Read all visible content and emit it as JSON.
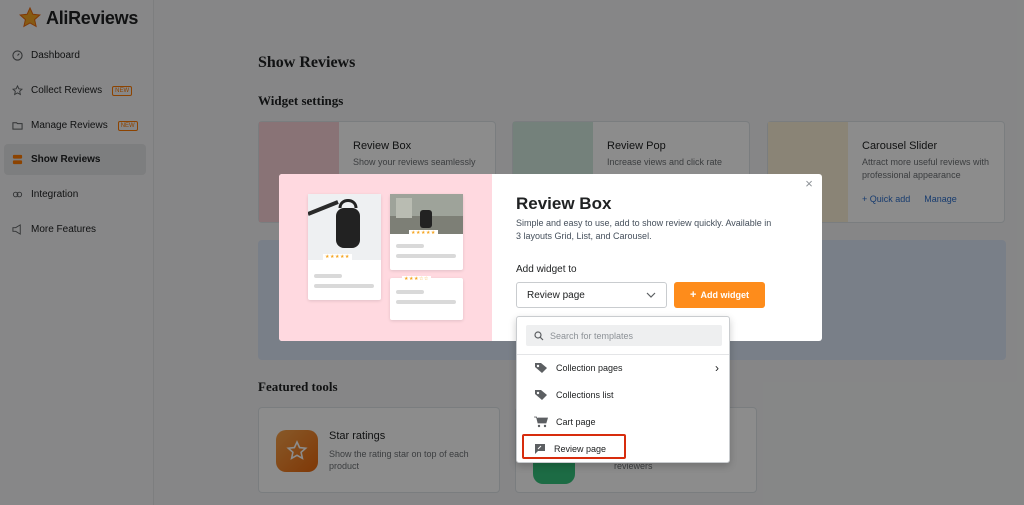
{
  "app": {
    "name": "AliReviews"
  },
  "sidebar": {
    "items": [
      {
        "label": "Dashboard",
        "icon": "dashboard-icon",
        "badge": ""
      },
      {
        "label": "Collect Reviews",
        "icon": "star-icon",
        "badge": "NEW"
      },
      {
        "label": "Manage Reviews",
        "icon": "folder-icon",
        "badge": "NEW"
      },
      {
        "label": "Show Reviews",
        "icon": "layout-icon",
        "badge": ""
      },
      {
        "label": "Integration",
        "icon": "integration-icon",
        "badge": ""
      },
      {
        "label": "More Features",
        "icon": "megaphone-icon",
        "badge": ""
      }
    ]
  },
  "main": {
    "page_title": "Show Reviews",
    "widget_settings_title": "Widget settings",
    "widgets": [
      {
        "title": "Review Box",
        "desc": "Show your reviews seamlessly"
      },
      {
        "title": "Review Pop",
        "desc": "Increase views and click rate"
      },
      {
        "title": "Carousel Slider",
        "desc": "Attract more useful reviews with professional appearance",
        "link1": "+ Quick add",
        "link2": "Manage"
      }
    ],
    "featured_title": "Featured tools",
    "featured": [
      {
        "title": "Star ratings",
        "desc": "Show the rating star on top of each product"
      },
      {
        "title": "",
        "desc": "reviewers"
      }
    ]
  },
  "modal": {
    "title": "Review Box",
    "desc": "Simple and easy to use, add to show review quickly. Available in 3 layouts Grid, List, and Carousel.",
    "add_to_label": "Add widget to",
    "select_value": "Review page",
    "add_button": "Add widget",
    "close": "×"
  },
  "dropdown": {
    "search_placeholder": "Search for templates",
    "items": [
      {
        "label": "Collection pages",
        "icon": "tag-icon"
      },
      {
        "label": "Collections list",
        "icon": "tags-icon"
      },
      {
        "label": "Cart page",
        "icon": "cart-icon"
      },
      {
        "label": "Review page",
        "icon": "review-icon"
      }
    ]
  },
  "colors": {
    "accent": "#fe8c1b",
    "link": "#2c6ecb",
    "highlight": "#d72c0d",
    "modal_left_bg": "#ffd9e0"
  }
}
